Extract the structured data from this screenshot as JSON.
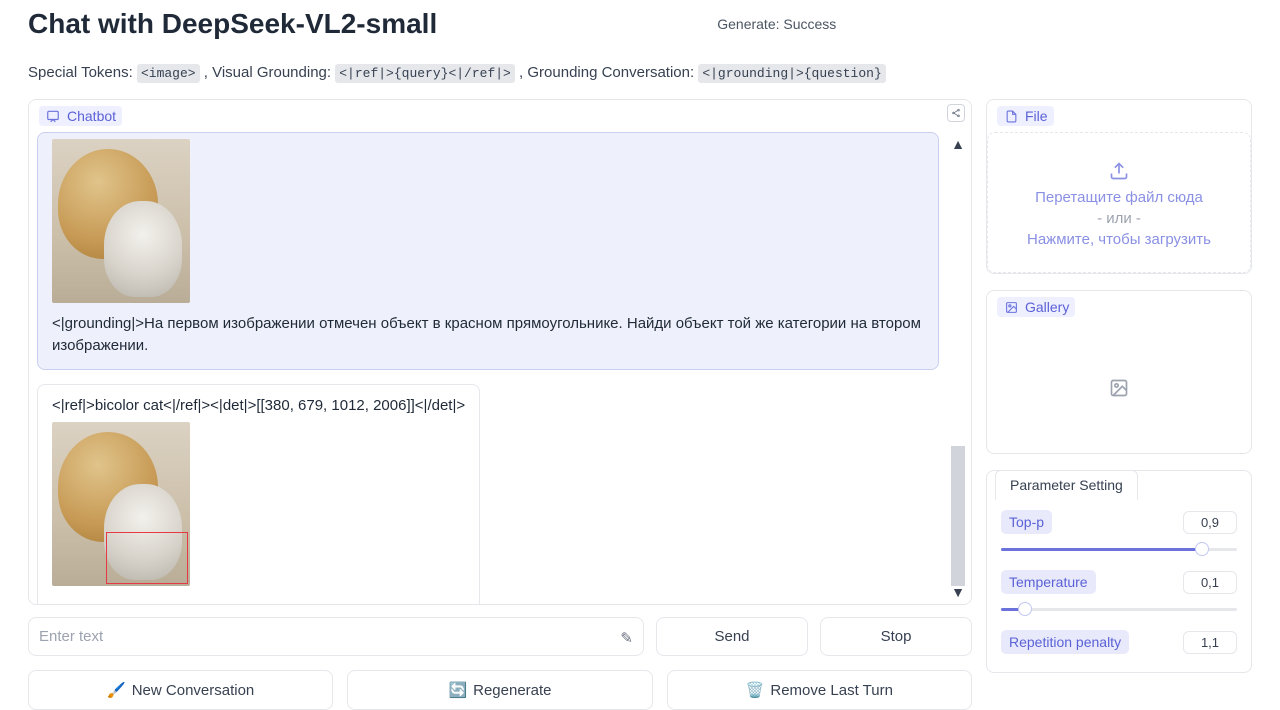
{
  "header": {
    "title": "Chat with DeepSeek-VL2-small",
    "status": "Generate: Success"
  },
  "subheader": {
    "special_tokens_label": "Special Tokens: ",
    "image_token": "<image>",
    "visual_grounding_label": ", Visual Grounding: ",
    "ref_token": "<|ref|>{query}<|/ref|>",
    "grounding_conv_label": ", Grounding Conversation: ",
    "grounding_token": "<|grounding|>{question}"
  },
  "chat": {
    "panel_label": "Chatbot",
    "user_message": "<|grounding|>На первом изображении отмечен объект в красном прямоугольнике. Найди объект той же категории на втором изображении.",
    "bot_message": "<|ref|>bicolor cat<|/ref|><|det|>[[380, 679, 1012, 2006]]<|/det|>"
  },
  "input": {
    "placeholder": "Enter text",
    "send": "Send",
    "stop": "Stop"
  },
  "actions": {
    "new_conversation": "New Conversation",
    "regenerate": "Regenerate",
    "remove_last": "Remove Last Turn"
  },
  "file_panel": {
    "label": "File",
    "drop_text": "Перетащите файл сюда",
    "or_text": "- или -",
    "click_text": "Нажмите, чтобы загрузить"
  },
  "gallery": {
    "label": "Gallery"
  },
  "params": {
    "tab_label": "Parameter Setting",
    "items": [
      {
        "label": "Top-p",
        "value": "0,9",
        "fill": 85
      },
      {
        "label": "Temperature",
        "value": "0,1",
        "fill": 10
      },
      {
        "label": "Repetition penalty",
        "value": "1,1",
        "fill": 0
      }
    ]
  }
}
